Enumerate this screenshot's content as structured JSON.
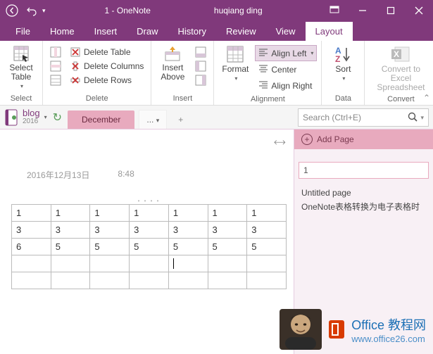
{
  "title": "1 - OneNote",
  "user": "huqiang ding",
  "menus": {
    "file": "File",
    "home": "Home",
    "insert": "Insert",
    "draw": "Draw",
    "history": "History",
    "review": "Review",
    "view": "View",
    "layout": "Layout"
  },
  "ribbon": {
    "select": {
      "btn": "Select\nTable",
      "group": "Select"
    },
    "delete": {
      "deleteTable": "Delete Table",
      "deleteColumns": "Delete Columns",
      "deleteRows": "Delete Rows",
      "group": "Delete"
    },
    "insert": {
      "btn": "Insert\nAbove",
      "group": "Insert"
    },
    "format": {
      "btn": "Format",
      "left": "Align Left",
      "center": "Center",
      "right": "Align Right",
      "group": "Alignment"
    },
    "data": {
      "sort": "Sort",
      "group": "Data"
    },
    "convert": {
      "btn": "Convert to Excel\nSpreadsheet",
      "group": "Convert"
    }
  },
  "notebook": {
    "name": "blog",
    "sub": "2016",
    "section": "December",
    "more": "...",
    "add": "+"
  },
  "search": {
    "placeholder": "Search (Ctrl+E)"
  },
  "page": {
    "date": "2016年12月13日",
    "time": "8:48"
  },
  "table": {
    "rows": [
      [
        "1",
        "1",
        "1",
        "1",
        "1",
        "1",
        "1"
      ],
      [
        "3",
        "3",
        "3",
        "3",
        "3",
        "3",
        "3"
      ],
      [
        "6",
        "5",
        "5",
        "5",
        "5",
        "5",
        "5"
      ],
      [
        "",
        "",
        "",
        "",
        "",
        "",
        ""
      ],
      [
        "",
        "",
        "",
        "",
        "",
        "",
        ""
      ]
    ]
  },
  "rpanel": {
    "addPage": "Add Page",
    "currentPage": "1",
    "pages": [
      "Untitled page",
      "OneNote表格转换为电子表格时"
    ]
  },
  "watermark": {
    "line1": "Office 教程网",
    "line2": "www.office26.com"
  }
}
